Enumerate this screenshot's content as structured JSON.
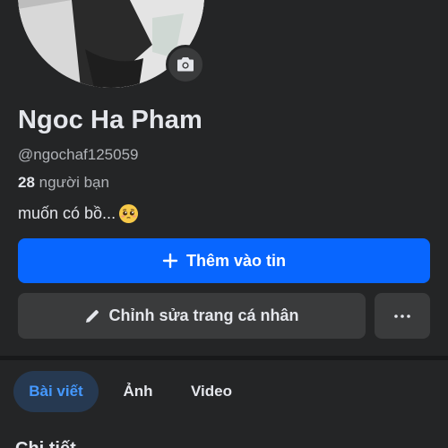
{
  "profile": {
    "name": "Ngoc Ha Pham",
    "username": "@ngochaf125059",
    "friends_count": "28",
    "friends_label": "người bạn",
    "bio_text": "muốn có bồ...",
    "bio_emoji": "pleading-face-emoji"
  },
  "actions": {
    "add_story_label": "Thêm vào tin",
    "edit_profile_label": "Chỉnh sửa trang cá nhân",
    "more_icon": "more-horizontal-icon"
  },
  "tabs": [
    {
      "label": "Bài viết",
      "active": true
    },
    {
      "label": "Ảnh",
      "active": false
    },
    {
      "label": "Video",
      "active": false
    }
  ],
  "section": {
    "title": "Chi tiết"
  },
  "colors": {
    "background": "#242526",
    "primary_button": "#0866ff",
    "secondary_button": "#3a3b3c",
    "active_tab_bg": "#263951",
    "active_tab_text": "#4599ff"
  },
  "icons": {
    "camera": "camera-icon",
    "plus": "plus-icon",
    "pencil": "pencil-icon"
  }
}
